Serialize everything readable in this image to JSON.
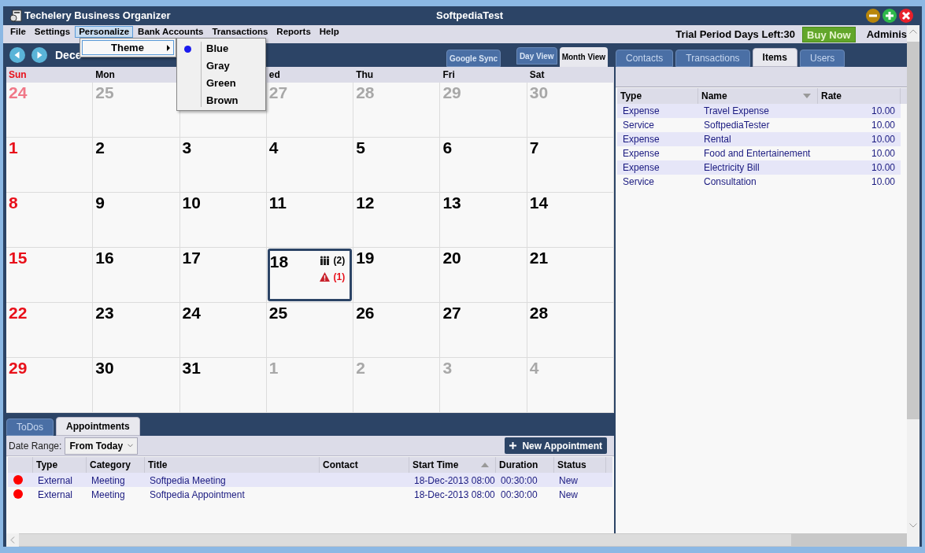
{
  "window": {
    "title": "Techelery Business Organizer",
    "user": "SoftpediaTest"
  },
  "menu": [
    {
      "label": "File",
      "selected": false
    },
    {
      "label": "Settings",
      "selected": false
    },
    {
      "label": "Personalize",
      "selected": true
    },
    {
      "label": "Bank Accounts",
      "selected": false
    },
    {
      "label": "Transactions",
      "selected": false
    },
    {
      "label": "Reports",
      "selected": false
    },
    {
      "label": "Help",
      "selected": false
    }
  ],
  "trial": "Trial Period Days Left:30",
  "buy_button": "Buy Now",
  "account": "Adminis",
  "personalize_menu": [
    {
      "label": "Theme",
      "submenu": true
    }
  ],
  "theme_menu": [
    {
      "label": "Blue",
      "selected": true
    },
    {
      "label": "Gray",
      "selected": false
    },
    {
      "label": "Green",
      "selected": false
    },
    {
      "label": "Brown",
      "selected": false
    }
  ],
  "calendar": {
    "title": "Dece",
    "sync_button": "Google Sync",
    "views": [
      {
        "label": "Day View",
        "selected": false
      },
      {
        "label": "Month View",
        "selected": true
      }
    ],
    "weekdays": [
      {
        "label": "Sun",
        "weekend": true
      },
      {
        "label": "Mon",
        "weekend": false
      },
      {
        "kind": "covered"
      },
      {
        "label": "ed",
        "weekend": false
      },
      {
        "label": "Thu",
        "weekend": false
      },
      {
        "label": "Fri",
        "weekend": false
      },
      {
        "label": "Sat",
        "weekend": false
      }
    ],
    "days": [
      {
        "day": "24",
        "kind": "other"
      },
      {
        "day": "25",
        "kind": "other"
      },
      {
        "kind": "hidden"
      },
      {
        "day": "27",
        "kind": "other"
      },
      {
        "day": "28",
        "kind": "other"
      },
      {
        "day": "29",
        "kind": "other"
      },
      {
        "day": "30",
        "kind": "other"
      },
      {
        "day": "1",
        "kind": "current"
      },
      {
        "day": "2",
        "kind": "current"
      },
      {
        "day": "3",
        "kind": "current"
      },
      {
        "day": "4",
        "kind": "current"
      },
      {
        "day": "5",
        "kind": "current"
      },
      {
        "day": "6",
        "kind": "current"
      },
      {
        "day": "7",
        "kind": "current"
      },
      {
        "day": "8",
        "kind": "current"
      },
      {
        "day": "9",
        "kind": "current"
      },
      {
        "day": "10",
        "kind": "current"
      },
      {
        "day": "11",
        "kind": "current"
      },
      {
        "day": "12",
        "kind": "current"
      },
      {
        "day": "13",
        "kind": "current"
      },
      {
        "day": "14",
        "kind": "current"
      },
      {
        "day": "15",
        "kind": "current"
      },
      {
        "day": "16",
        "kind": "current"
      },
      {
        "day": "17",
        "kind": "current"
      },
      {
        "day": "18",
        "kind": "current",
        "selected": true,
        "badges": [
          {
            "kind": "people",
            "count": "(2)"
          },
          {
            "kind": "alert",
            "count": "(1)"
          }
        ]
      },
      {
        "day": "19",
        "kind": "current"
      },
      {
        "day": "20",
        "kind": "current"
      },
      {
        "day": "21",
        "kind": "current"
      },
      {
        "day": "22",
        "kind": "current"
      },
      {
        "day": "23",
        "kind": "current"
      },
      {
        "day": "24",
        "kind": "current"
      },
      {
        "day": "25",
        "kind": "current"
      },
      {
        "day": "26",
        "kind": "current"
      },
      {
        "day": "27",
        "kind": "current"
      },
      {
        "day": "28",
        "kind": "current"
      },
      {
        "day": "29",
        "kind": "current"
      },
      {
        "day": "30",
        "kind": "current"
      },
      {
        "day": "31",
        "kind": "current"
      },
      {
        "day": "1",
        "kind": "other"
      },
      {
        "day": "2",
        "kind": "other"
      },
      {
        "day": "3",
        "kind": "other"
      },
      {
        "day": "4",
        "kind": "other"
      }
    ]
  },
  "bottom": {
    "tabs": [
      {
        "label": "ToDos",
        "selected": false
      },
      {
        "label": "Appointments",
        "selected": true
      }
    ],
    "date_range_label": "Date Range:",
    "date_range_value": "From Today",
    "new_button": "New Appointment",
    "columns": [
      {
        "label": "Type"
      },
      {
        "label": "Category"
      },
      {
        "label": "Title"
      },
      {
        "label": "Contact"
      },
      {
        "label": "Start Time",
        "sorted": true
      },
      {
        "label": "Duration"
      },
      {
        "label": "Status"
      }
    ],
    "rows": [
      {
        "color": "#ff0000",
        "cells": [
          "External",
          "Meeting",
          "Softpedia Meeting",
          "",
          "18-Dec-2013 08:00",
          "00:30:00",
          "New"
        ]
      },
      {
        "color": "#ff0000",
        "cells": [
          "External",
          "Meeting",
          "Softpedia Appointment",
          "",
          "18-Dec-2013 08:00",
          "00:30:00",
          "New"
        ]
      }
    ]
  },
  "right": {
    "tabs": [
      {
        "label": "Contacts",
        "selected": false
      },
      {
        "label": "Transactions",
        "selected": false
      },
      {
        "label": "Items",
        "selected": true
      },
      {
        "label": "Users",
        "selected": false
      }
    ],
    "columns": [
      {
        "label": "Type"
      },
      {
        "label": "Name",
        "sorted": true
      },
      {
        "label": "Rate"
      }
    ],
    "rows": [
      [
        "Expense",
        "Travel Expense",
        "10.00"
      ],
      [
        "Service",
        "SoftpediaTester",
        "10.00"
      ],
      [
        "Expense",
        "Rental",
        "10.00"
      ],
      [
        "Expense",
        "Food and Entertainement",
        "10.00"
      ],
      [
        "Expense",
        "Electricity Bill",
        "10.00"
      ],
      [
        "Service",
        "Consultation",
        "10.00"
      ]
    ]
  }
}
